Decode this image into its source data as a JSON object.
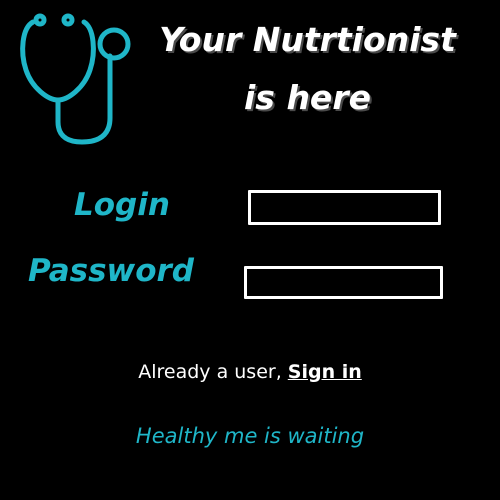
{
  "logo": {
    "icon": "stethoscope-icon",
    "color": "#1fb6c8"
  },
  "header": {
    "title_line1": "Your Nutrtionist",
    "title_line2": "is here"
  },
  "form": {
    "login_label": "Login",
    "login_value": "",
    "password_label": "Password",
    "password_value": ""
  },
  "signin": {
    "prompt": "Already a user, ",
    "link_label": "Sign in"
  },
  "tagline": "Healthy me is waiting",
  "colors": {
    "accent": "#1fb6c8",
    "text": "#ffffff",
    "background": "#000000"
  }
}
